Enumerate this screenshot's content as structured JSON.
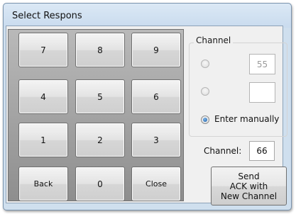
{
  "window": {
    "title": "Select Respons"
  },
  "keypad": {
    "keys": [
      "7",
      "8",
      "9",
      "4",
      "5",
      "6",
      "1",
      "2",
      "3",
      "Back",
      "0",
      "Close"
    ]
  },
  "channel_group": {
    "title": "Channel",
    "option1_value": "55",
    "option2_value": "",
    "option3_label": "Enter manually",
    "selected_option": 3
  },
  "channel_field": {
    "label": "Channel:",
    "value": "66"
  },
  "send_button": {
    "line1": "Send",
    "line2": "ACK with",
    "line3": "New Channel"
  }
}
